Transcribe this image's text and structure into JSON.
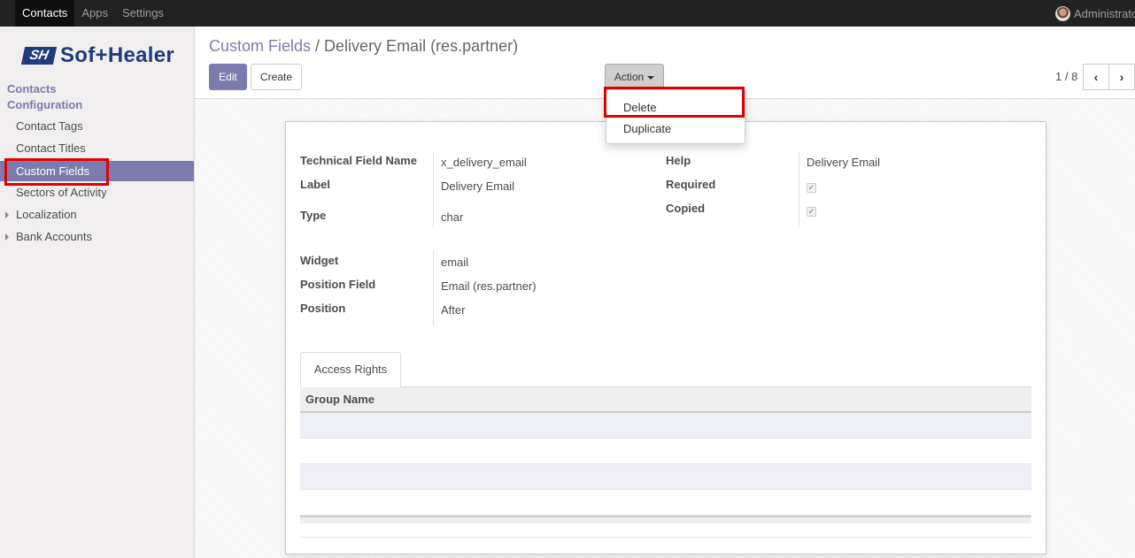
{
  "topbar": {
    "menu": [
      "Contacts",
      "Apps",
      "Settings"
    ],
    "user": "Administrato"
  },
  "logo": {
    "mark": "SH",
    "text": "Sof+Healer"
  },
  "sidebar": {
    "section1": "Contacts",
    "section2": "Configuration",
    "items": [
      "Contact Tags",
      "Contact Titles",
      "Custom Fields",
      "Sectors of Activity",
      "Localization",
      "Bank Accounts"
    ],
    "active": "Custom Fields"
  },
  "breadcrumb": {
    "parent": "Custom Fields",
    "sep": "/",
    "current": "Delivery Email (res.partner)"
  },
  "buttons": {
    "edit": "Edit",
    "create": "Create",
    "action": "Action"
  },
  "pager": {
    "text": "1 / 8",
    "prev": "‹",
    "next": "›"
  },
  "action_menu": {
    "items": [
      "Delete",
      "Duplicate"
    ]
  },
  "form": {
    "left": [
      {
        "label": "Technical Field Name",
        "value": "x_delivery_email"
      },
      {
        "label": "Label",
        "value": "Delivery Email"
      },
      {
        "label": "Type",
        "value": "char"
      },
      {
        "label": "Widget",
        "value": "email"
      },
      {
        "label": "Position Field",
        "value": "Email (res.partner)"
      },
      {
        "label": "Position",
        "value": "After"
      }
    ],
    "right": [
      {
        "label": "Help",
        "value": "Delivery Email"
      },
      {
        "label": "Required",
        "value": "✔"
      },
      {
        "label": "Copied",
        "value": "✔"
      }
    ]
  },
  "tabs": {
    "access_rights": "Access Rights"
  },
  "table": {
    "header": "Group Name"
  }
}
